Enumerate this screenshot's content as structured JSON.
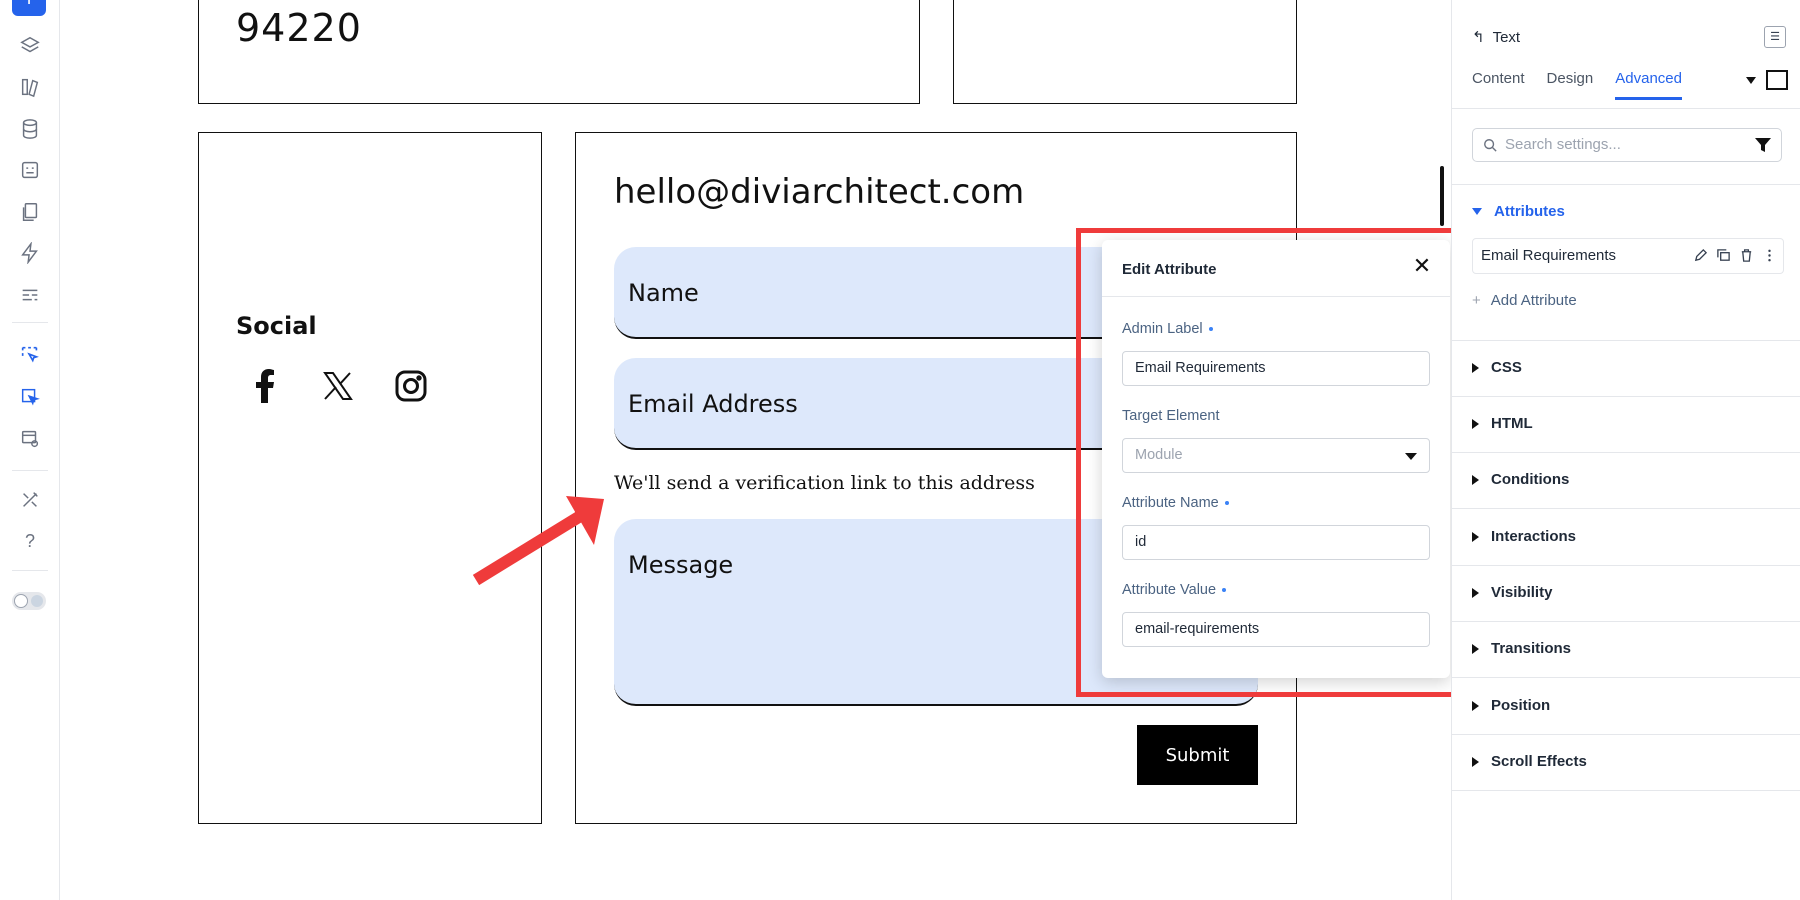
{
  "canvas": {
    "zip": "94220",
    "social_heading": "Social",
    "social_icons": [
      "facebook-icon",
      "x-icon",
      "instagram-icon"
    ],
    "email": "hello@diviarchitect.com",
    "fields": {
      "name": "Name",
      "email": "Email Address",
      "message": "Message"
    },
    "helper_text": "We'll send a verification link to this address",
    "submit_label": "Submit"
  },
  "modal": {
    "title": "Edit Attribute",
    "admin_label": {
      "label": "Admin Label",
      "value": "Email Requirements"
    },
    "target_element": {
      "label": "Target Element",
      "value": "Module"
    },
    "attribute_name": {
      "label": "Attribute Name",
      "value": "id"
    },
    "attribute_value": {
      "label": "Attribute Value",
      "value": "email-requirements"
    }
  },
  "panel": {
    "back_label": "Text",
    "tabs": [
      "Content",
      "Design",
      "Advanced"
    ],
    "active_tab": "Advanced",
    "search_placeholder": "Search settings...",
    "attributes": {
      "heading": "Attributes",
      "item": "Email Requirements",
      "add_label": "Add Attribute"
    },
    "sections": [
      "CSS",
      "HTML",
      "Conditions",
      "Interactions",
      "Visibility",
      "Transitions",
      "Position",
      "Scroll Effects"
    ]
  },
  "colors": {
    "accent": "#2563eb",
    "highlight": "#ef3b3b",
    "field_bg": "#dde8fb"
  }
}
